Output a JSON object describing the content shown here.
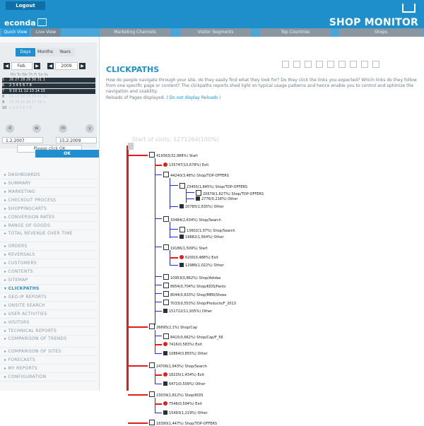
{
  "header": {
    "logout_label": "Logout",
    "logo_text": "econda",
    "brand_title": "SHOP MONITOR"
  },
  "tabs": [
    {
      "label": "Quick View"
    },
    {
      "label": "Live View"
    },
    {
      "label": "Marketing Channels"
    },
    {
      "label": "Visitor Segments"
    },
    {
      "label": "Top Countries"
    },
    {
      "label": "Shops"
    }
  ],
  "calendar": {
    "period_tabs": [
      "Days",
      "Months",
      "Years"
    ],
    "month": "Feb.",
    "year": "2009",
    "weekday_header": "Mo Tu We Th Fr Sa Su",
    "rows": [
      "26 27 28 29 30 31 1",
      "2 3 4 5 6 7 8",
      "9 10 11 12 13 14 15",
      "16 17 18 19 20 21 22",
      "23 24 25 26 27 28 1",
      "2 3 4 5 6 7 8"
    ],
    "row_numbers": [
      "5",
      "6",
      "7",
      "8",
      "9",
      "10"
    ],
    "date_from": "1.2.2007",
    "date_to": "15.2.2009",
    "please_click": "Please click OK",
    "ok_label": "OK"
  },
  "menu": [
    "DASHBOARDS",
    "SUMMARY",
    "MARKETING",
    "CHECKOUT PROCESS",
    "SHOPPINGCARTS",
    "CONVERSION RATES",
    "RANGE OF GOODS",
    "TOTAL REVENUE OVER TIME",
    "ORDERS",
    "REVERSALS",
    "CUSTOMERS",
    "CONTENTS",
    "SITEMAP",
    "CLICKPATHS",
    "GEO-IP REPORTS",
    "ONSITE SEARCH",
    "USER ACTIVITIES",
    "VISITORS",
    "TECHNICAL REPORTS",
    "COMPARISON OF TRENDS",
    "COMPARISON OF SITES",
    "FORECASTS",
    "MY REPORTS",
    "CONFIGURATION"
  ],
  "main": {
    "title": "CLICKPATHS",
    "description": "How do people navigate through your site, do they easily find what they look for? Do they click the links you expected? Which links do they follow from one specific page or content? The clickpaths reports shed light on typical usage patterns and hence enable you to control and optimize the navigation and usability.",
    "reload_text": "Reloads of Pages displayed.",
    "reload_link": "( Do not display Reloads )",
    "start_label": "Start of visits, 1271264(100%)"
  },
  "tree": [
    "419363(32,988%) Start",
    "135747(10,678%) Exit",
    "44240(3,48%) Shop/TOP-OFFERS",
    "23455(1,845%) Shop/TOP-OFFERS",
    "20679(1,627%) Shop/TOP-OFFERS",
    "2776(0,218%) Other",
    "20785(1,635%) Other",
    "33484(2,634%) Shop/Search",
    "13602(1,07%) Shop/Search",
    "19882(1,564%) Other",
    "19186(1,509%) Start",
    "6200(0,488%) Exit",
    "12986(1,022%) Other",
    "10953(0,862%) Shop/Adidas",
    "8954(0,704%) Shop/KIDS/Pants",
    "8044(0,633%) Shop/MEN/Shoes",
    "7033(0,553%) Shop/Products/F_2013",
    "151722(11,935%) Other",
    "26695(2,1%) Shop/Cap",
    "8415(0,662%) Shop/Cap/F_56",
    "7416(0,583%) Exit",
    "10864(0,855%) Other",
    "24706(1,943%) Shop/Search",
    "18235(1,434%) Exit",
    "6471(0,509%) Other",
    "23039(1,812%) Shop/KIDS",
    "7546(0,594%) Exit",
    "15493(1,219%) Other",
    "18390(1,447%) Shop/TOP-OFFERS"
  ]
}
